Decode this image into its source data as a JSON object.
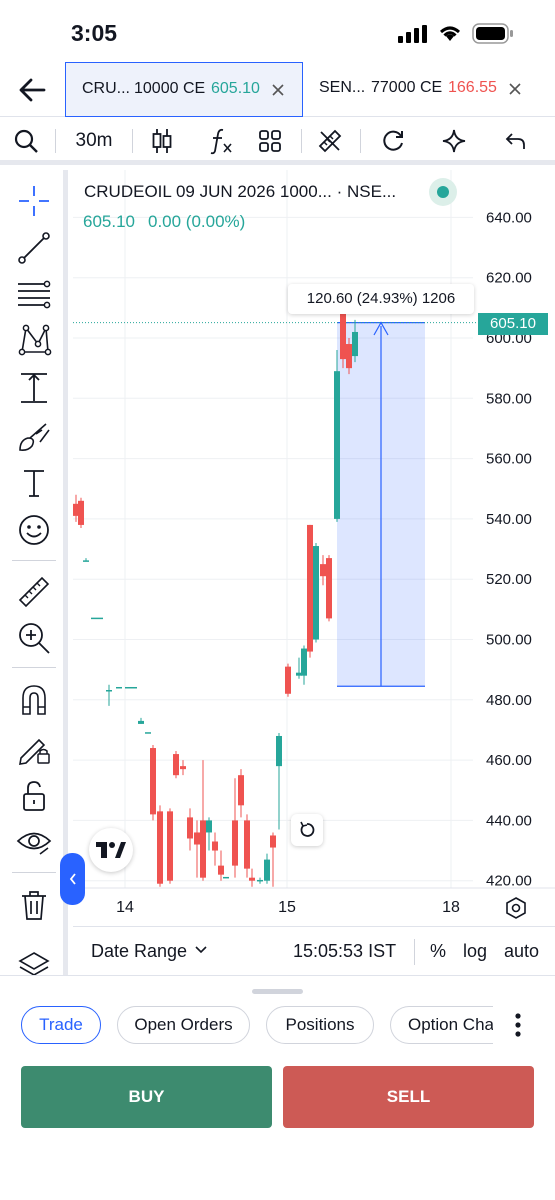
{
  "status_bar": {
    "time": "3:05"
  },
  "tabs": [
    {
      "symbol": "CRU...",
      "strike": "10000 CE",
      "price": "605.10",
      "price_color": "#26a69a",
      "active": true
    },
    {
      "symbol": "SEN...",
      "strike": "77000 CE",
      "price": "166.55",
      "price_color": "#ef5350",
      "active": false
    }
  ],
  "toolbar": {
    "interval": "30m"
  },
  "chart": {
    "title": "CRUDEOIL 09 JUN 2026 1000... · NSE...",
    "last_price": "605.10",
    "change": "0.00 (0.00%)",
    "price_axis": [
      "640.00",
      "620.00",
      "600.00",
      "580.00",
      "560.00",
      "540.00",
      "520.00",
      "500.00",
      "480.00",
      "460.00",
      "440.00",
      "420.00"
    ],
    "time_axis": [
      "14",
      "15",
      "18"
    ],
    "current_price_tag": "605.10",
    "measure_label": "120.60 (24.93%) 1206",
    "accent": "#2962ff",
    "up_color": "#26a69a",
    "down_color": "#ef5350"
  },
  "chart_bottom": {
    "date_range": "Date Range",
    "clock": "15:05:53 IST",
    "percent": "%",
    "log": "log",
    "auto": "auto"
  },
  "panel": {
    "tabs": [
      "Trade",
      "Open Orders",
      "Positions",
      "Option Cha"
    ],
    "buy_label": "BUY",
    "sell_label": "SELL",
    "buy_color": "#3d8b6f",
    "sell_color": "#cd5a55"
  }
}
